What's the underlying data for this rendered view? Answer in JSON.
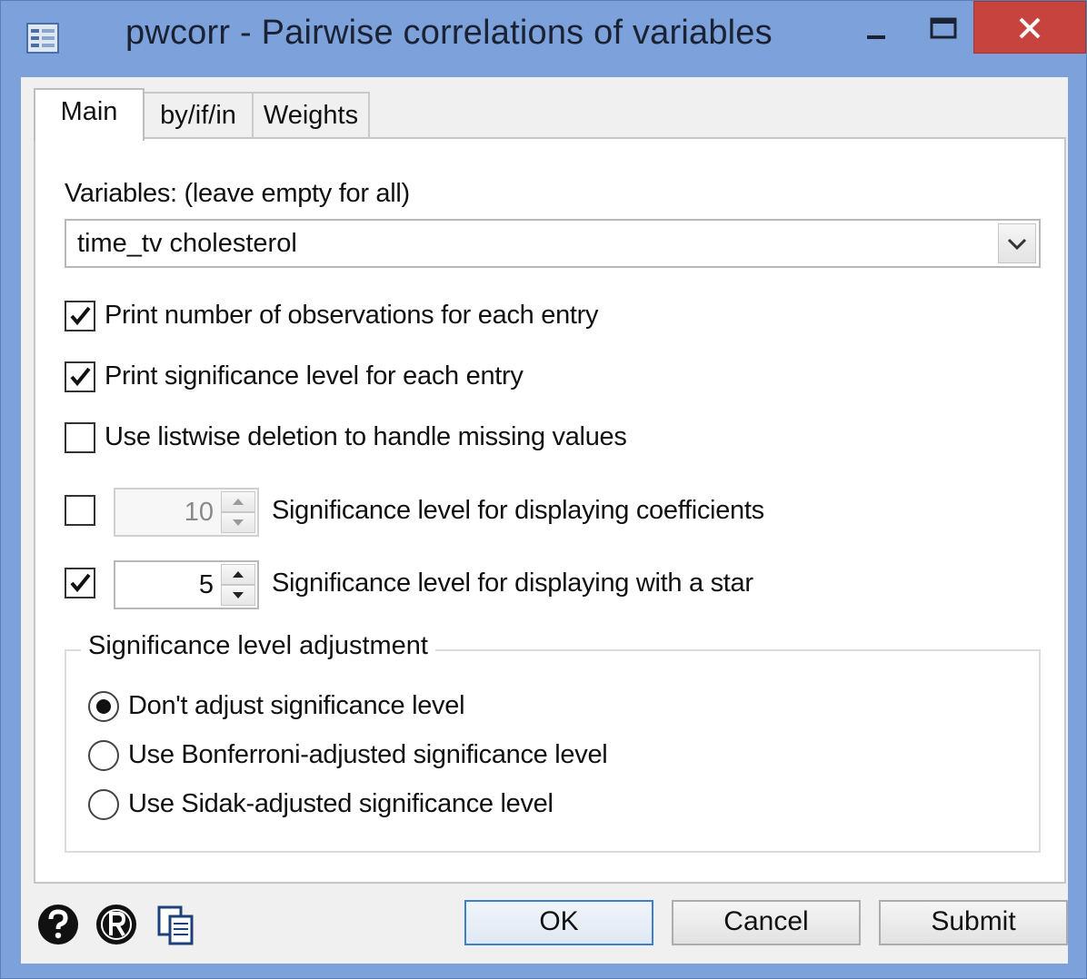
{
  "window": {
    "title": "pwcorr - Pairwise correlations of variables"
  },
  "tabs": [
    {
      "label": "Main",
      "active": true
    },
    {
      "label": "by/if/in",
      "active": false
    },
    {
      "label": "Weights",
      "active": false
    }
  ],
  "main": {
    "variables_label": "Variables: (leave empty for all)",
    "variables_value": "time_tv cholesterol",
    "options": [
      {
        "label": "Print number of observations for each entry",
        "checked": true
      },
      {
        "label": "Print significance level for each entry",
        "checked": true
      },
      {
        "label": "Use listwise deletion to handle missing values",
        "checked": false
      }
    ],
    "sig_coefficients": {
      "checked": false,
      "value": "10",
      "label": "Significance level for displaying coefficients"
    },
    "sig_star": {
      "checked": true,
      "value": "5",
      "label": "Significance level for displaying with a star"
    },
    "adjustment": {
      "title": "Significance level adjustment",
      "options": [
        {
          "label": "Don't adjust significance level",
          "selected": true
        },
        {
          "label": "Use Bonferroni-adjusted significance level",
          "selected": false
        },
        {
          "label": "Use Sidak-adjusted significance level",
          "selected": false
        }
      ]
    }
  },
  "footer": {
    "ok_label": "OK",
    "cancel_label": "Cancel",
    "submit_label": "Submit",
    "icons": [
      "help-icon",
      "reset-icon",
      "copy-command-icon"
    ]
  },
  "colors": {
    "title_bar": "#7da2db",
    "close_button": "#c7433d",
    "default_button_border": "#3c7fd1"
  }
}
